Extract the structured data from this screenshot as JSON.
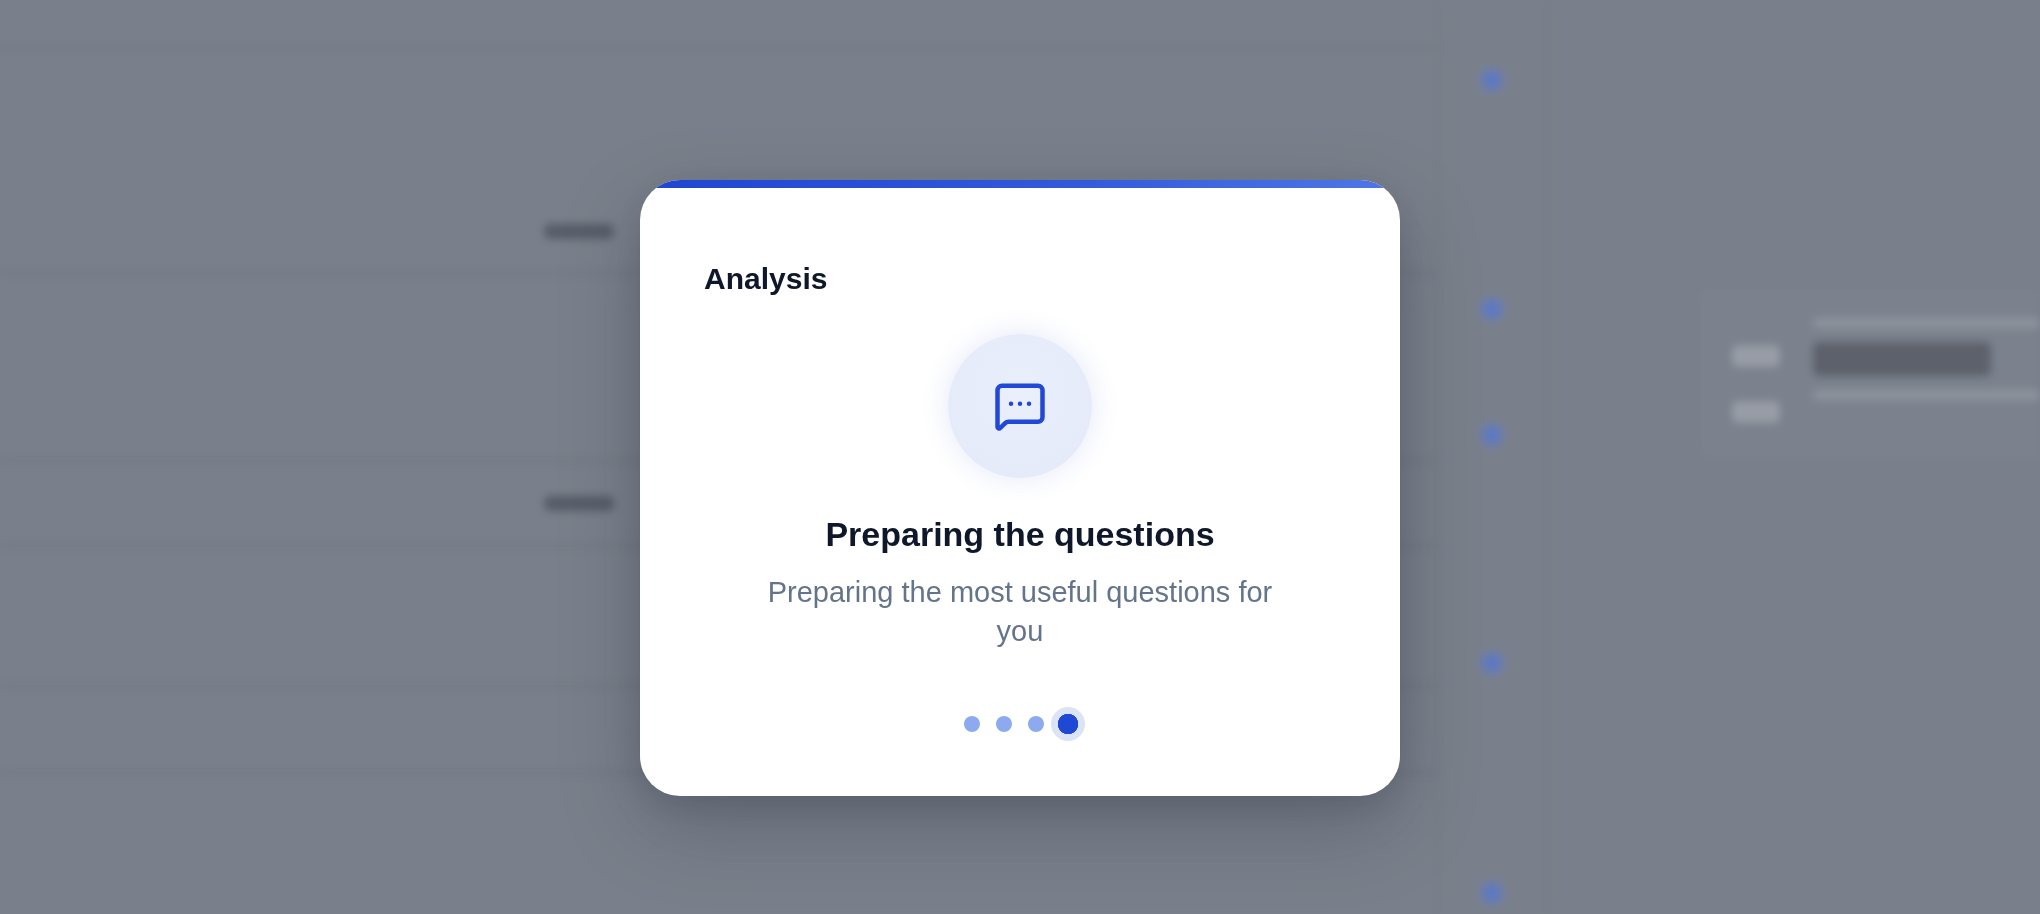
{
  "dialog": {
    "title": "Analysis",
    "status": {
      "heading": "Preparing the questions",
      "description": "Preparing the most useful questions for you"
    },
    "steps": [
      {
        "active": false
      },
      {
        "active": false
      },
      {
        "active": false
      },
      {
        "active": true
      }
    ]
  }
}
